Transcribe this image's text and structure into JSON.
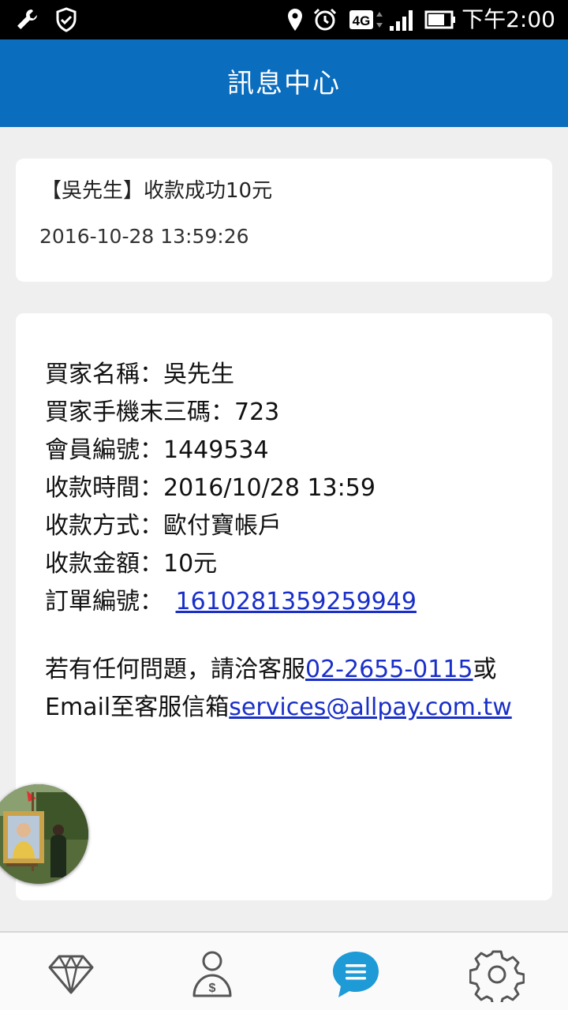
{
  "status_bar": {
    "time": "下午2:00",
    "network": "4G",
    "icons": [
      "wrench-icon",
      "shield-check-icon",
      "location-icon",
      "alarm-icon",
      "network-4g-icon",
      "signal-icon",
      "battery-icon"
    ]
  },
  "header": {
    "title": "訊息中心",
    "background_color": "#0b6dbd"
  },
  "summary": {
    "title": "【吳先生】收款成功10元",
    "timestamp": "2016-10-28 13:59:26"
  },
  "detail": {
    "buyer_name": "買家名稱：吳先生",
    "buyer_phone_last3": "買家手機末三碼：723",
    "member_id": "會員編號：1449534",
    "payment_time": "收款時間：2016/10/28 13:59",
    "payment_method": "收款方式：歐付寶帳戶",
    "payment_amount": "收款金額：10元",
    "order_label": "訂單編號：",
    "order_number": "1610281359259949"
  },
  "contact": {
    "line1_prefix": "若有任何問題，請洽客服",
    "phone": "02-2655-0115",
    "line1_suffix": "或",
    "line2_prefix": "Email至客服信箱",
    "email": "services@allpay.com.tw"
  },
  "bottom_nav": {
    "items": [
      "diamond-icon",
      "user-money-icon",
      "chat-icon",
      "settings-gear-icon"
    ],
    "active_index": 2,
    "active_color": "#1e9ad6"
  }
}
